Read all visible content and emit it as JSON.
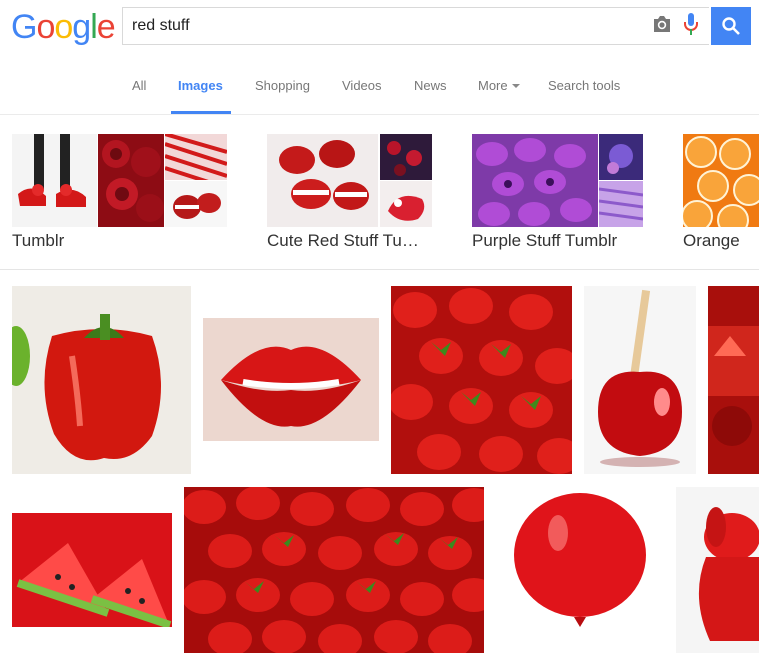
{
  "search": {
    "query": "red stuff"
  },
  "logo": {
    "letters": [
      "G",
      "o",
      "o",
      "g",
      "l",
      "e"
    ]
  },
  "tabs": [
    {
      "label": "All"
    },
    {
      "label": "Images"
    },
    {
      "label": "Shopping"
    },
    {
      "label": "Videos"
    },
    {
      "label": "News"
    },
    {
      "label": "More"
    },
    {
      "label": "Search tools"
    }
  ],
  "collections": [
    {
      "label": "Tumblr"
    },
    {
      "label": "Cute Red Stuff Tu…"
    },
    {
      "label": "Purple Stuff Tumblr"
    },
    {
      "label": "Orange"
    }
  ],
  "colors": {
    "accent": "#4285f4",
    "red": "#d21a1a"
  }
}
